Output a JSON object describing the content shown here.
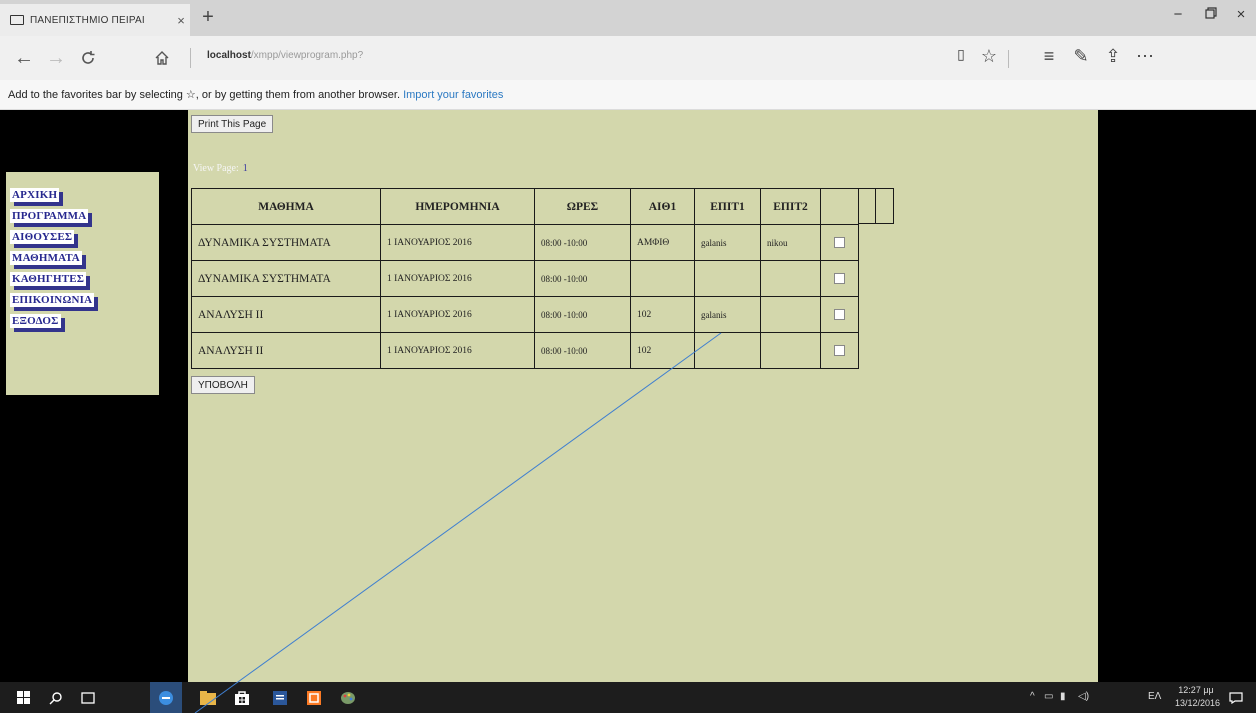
{
  "browser": {
    "tab_title": "ΠΑΝΕΠΙΣΤΗΜΙΟ ΠΕΙΡΑΙ",
    "tab_close": "×",
    "new_tab": "+",
    "url_host": "localhost",
    "url_path": "/xmpp/viewprogram.php?",
    "favorites_text": "Add to the favorites bar by selecting ☆, or by getting them from another browser.",
    "favorites_link": "Import your favorites",
    "minimize": "−",
    "maximize": "□",
    "close": "×"
  },
  "page": {
    "print_button": "Print This Page",
    "view_page_label": "View Page:",
    "view_page_number": "1",
    "submit_button": "ΥΠΟΒΟΛΗ"
  },
  "sidebar": {
    "items": [
      {
        "label": "ΑΡΧΙΚΗ"
      },
      {
        "label": "ΠΡΟΓΡΑΜΜΑ"
      },
      {
        "label": "ΑΙΘΟΥΣΕΣ"
      },
      {
        "label": "ΜΑΘΗΜΑΤΑ"
      },
      {
        "label": "ΚΑΘΗΓΗΤΕΣ"
      },
      {
        "label": "ΕΠΙΚΟΙΝΩΝΙΑ"
      },
      {
        "label": "ΕΞΟΔΟΣ"
      }
    ]
  },
  "table": {
    "headers": [
      "ΜΑΘΗΜΑ",
      "ΗΜΕΡΟΜΗΝΙΑ",
      "ΩΡΕΣ",
      "ΑΙΘ1",
      "ΕΠΙΤ1",
      "ΕΠΙΤ2",
      ""
    ],
    "rows": [
      [
        "ΔΥΝΑΜΙΚΑ ΣΥΣΤΗΜΑΤΑ",
        "1 ΙΑΝΟΥΑΡΙΟΣ 2016",
        "08:00 -10:00",
        "ΑΜΦΙΘ",
        "galanis",
        "nikou"
      ],
      [
        "ΔΥΝΑΜΙΚΑ ΣΥΣΤΗΜΑΤΑ",
        "1 ΙΑΝΟΥΑΡΙΟΣ 2016",
        "08:00 -10:00",
        "",
        "",
        ""
      ],
      [
        "ΑΝΑΛΥΣΗ ΙΙ",
        "1 ΙΑΝΟΥΑΡΙΟΣ 2016",
        "08:00 -10:00",
        "102",
        "galanis",
        ""
      ],
      [
        "ΑΝΑΛΥΣΗ ΙΙ",
        "1 ΙΑΝΟΥΑΡΙΟΣ 2016",
        "08:00 -10:00",
        "102",
        "",
        ""
      ]
    ]
  },
  "taskbar": {
    "lang": "ΕΛ",
    "time": "12:27 μμ",
    "date": "13/12/2016"
  }
}
